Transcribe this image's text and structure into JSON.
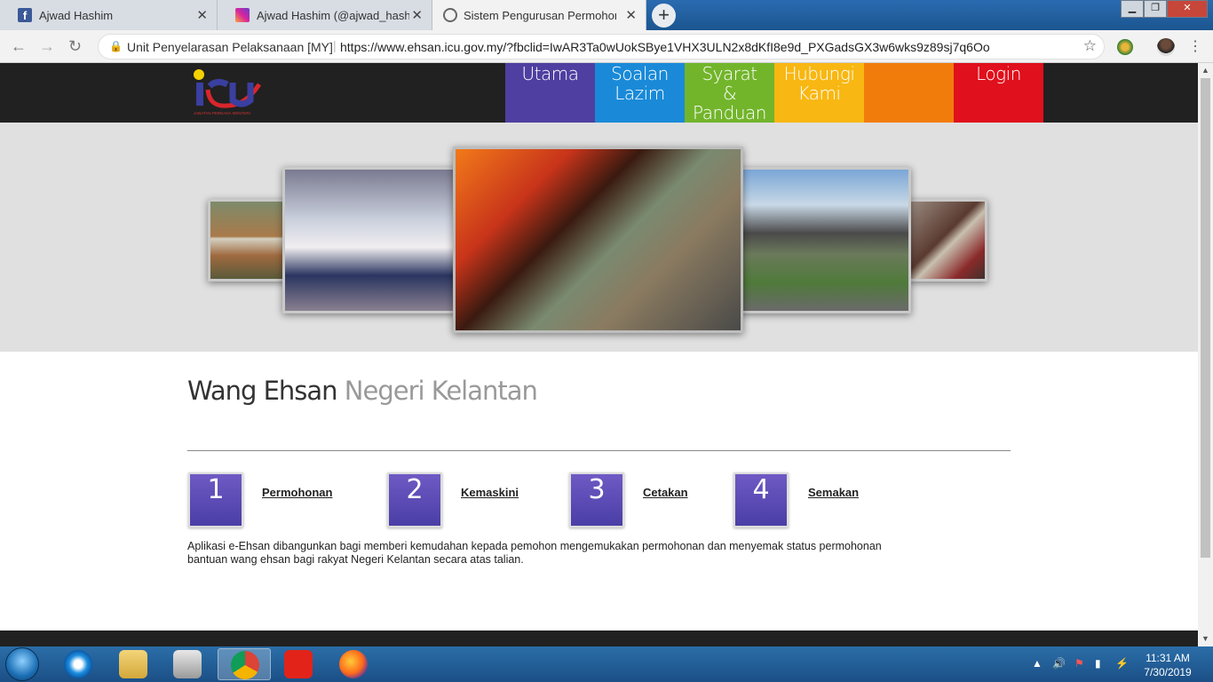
{
  "browser": {
    "tabs": [
      {
        "label": "Ajwad Hashim",
        "icon": "facebook-icon",
        "active": false
      },
      {
        "label": "Ajwad Hashim (@ajwad_hashim)",
        "icon": "instagram-icon",
        "active": false
      },
      {
        "label": "Sistem Pengurusan Permohonan",
        "icon": "globe-icon",
        "active": true
      }
    ],
    "new_tab": "+",
    "address": {
      "org": "Unit Penyelarasan Pelaksanaan [MY]",
      "url": "https://www.ehsan.icu.gov.my/?fbclid=IwAR3Ta0wUokSBye1VHX3ULN2x8dKfI8e9d_PXGadsGX3w6wks9z89sj7q6Oo"
    },
    "colors": {
      "frame": "#1e5d9b",
      "tab_inactive": "#d8dde4",
      "tab_active": "#f2f2f2"
    }
  },
  "site": {
    "logo_text": "icu",
    "logo_caption": "JABATAN PERDANA MENTERI",
    "menu": [
      {
        "label": "Utama",
        "color": "#4f3fa0"
      },
      {
        "label": "Soalan Lazim",
        "color": "#1a8ad8"
      },
      {
        "label": "Syarat & Panduan",
        "color": "#72b52b"
      },
      {
        "label": "Hubungi Kami",
        "color": "#f8b712"
      },
      {
        "label": "",
        "color": "#f27c0b"
      },
      {
        "label": "Login",
        "color": "#e0101c"
      }
    ],
    "title_main": "Wang Ehsan",
    "title_sub": "Negeri Kelantan",
    "steps": [
      {
        "number": "1",
        "label": "Permohonan"
      },
      {
        "number": "2",
        "label": "Kemaskini"
      },
      {
        "number": "3",
        "label": "Cetakan"
      },
      {
        "number": "4",
        "label": "Semakan"
      }
    ],
    "description": "Aplikasi e-Ehsan dibangunkan bagi memberi kemudahan kepada pemohon mengemukakan permohonan dan menyemak status permohonan bantuan wang ehsan bagi rakyat Negeri Kelantan secara atas talian."
  },
  "taskbar": {
    "time": "11:31 AM",
    "date": "7/30/2019",
    "apps": [
      "internet-explorer-icon",
      "file-explorer-icon",
      "media-player-icon",
      "chrome-icon",
      "app-icon",
      "firefox-icon"
    ]
  }
}
